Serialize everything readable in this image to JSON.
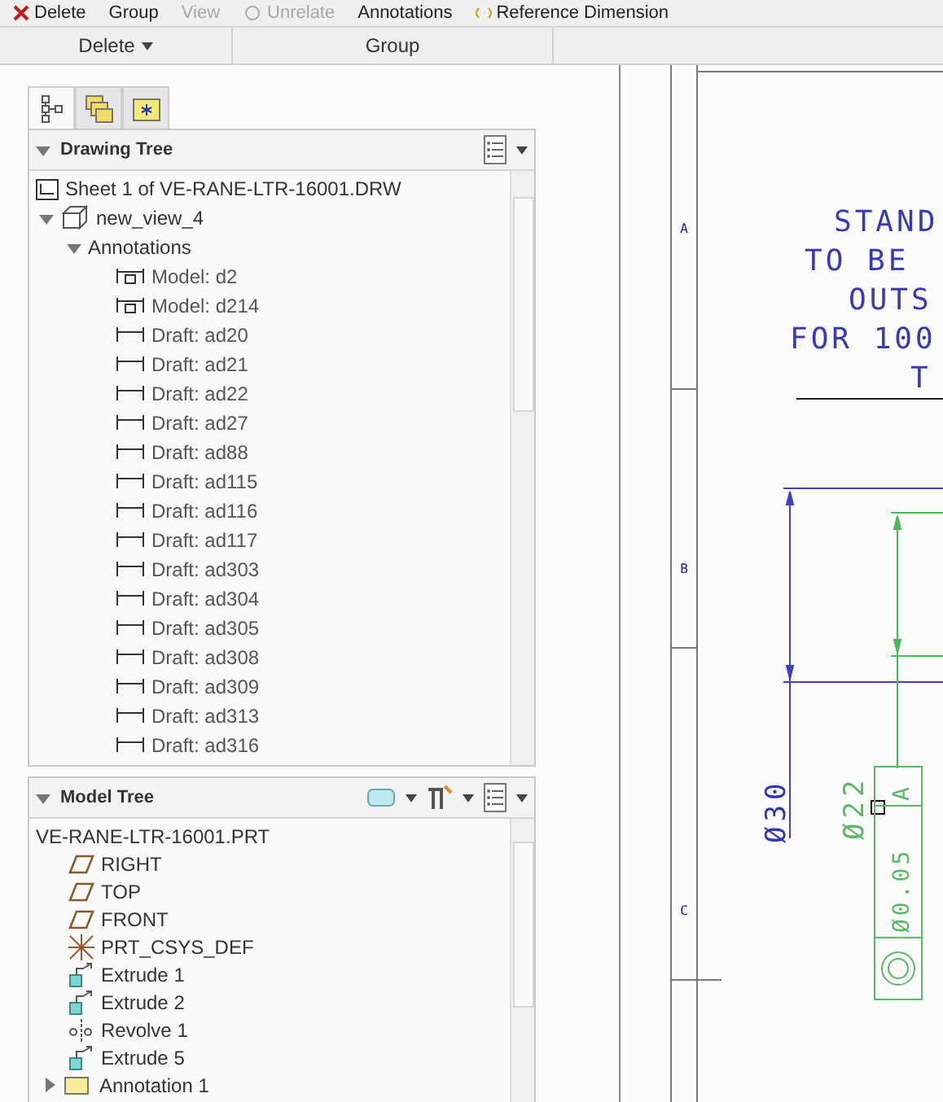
{
  "ribbon": {
    "commands": [
      {
        "label": "Delete",
        "kind": "delete",
        "disabled": false
      },
      {
        "label": "Group",
        "kind": "plain",
        "disabled": false
      },
      {
        "label": "View",
        "kind": "plain",
        "disabled": true
      },
      {
        "label": "Unrelate",
        "kind": "unrelate",
        "disabled": true
      },
      {
        "label": "Annotations",
        "kind": "plain",
        "disabled": false
      },
      {
        "label": "Reference Dimension",
        "kind": "refdim",
        "disabled": false
      }
    ],
    "groups": [
      {
        "label": "Delete",
        "dropdown": true
      },
      {
        "label": "Group",
        "dropdown": false
      }
    ]
  },
  "panel_tabs": [
    {
      "kind": "tree",
      "selected": true
    },
    {
      "kind": "folders",
      "selected": false
    },
    {
      "kind": "favorites",
      "selected": false
    }
  ],
  "drawing_tree": {
    "title": "Drawing Tree",
    "expanded": true,
    "sheet": "Sheet 1 of VE-RANE-LTR-16001.DRW",
    "items": [
      {
        "label": "new_view_4",
        "kind": "view",
        "expanded": true,
        "children": [
          {
            "label": "Annotations",
            "expanded": true,
            "children": [
              {
                "label": "Model: d2",
                "kind": "model"
              },
              {
                "label": "Model: d214",
                "kind": "model"
              },
              {
                "label": "Draft: ad20",
                "kind": "draft"
              },
              {
                "label": "Draft: ad21",
                "kind": "draft"
              },
              {
                "label": "Draft: ad22",
                "kind": "draft"
              },
              {
                "label": "Draft: ad27",
                "kind": "draft"
              },
              {
                "label": "Draft: ad88",
                "kind": "draft"
              },
              {
                "label": "Draft: ad115",
                "kind": "draft"
              },
              {
                "label": "Draft: ad116",
                "kind": "draft"
              },
              {
                "label": "Draft: ad117",
                "kind": "draft"
              },
              {
                "label": "Draft: ad303",
                "kind": "draft"
              },
              {
                "label": "Draft: ad304",
                "kind": "draft"
              },
              {
                "label": "Draft: ad305",
                "kind": "draft"
              },
              {
                "label": "Draft: ad308",
                "kind": "draft"
              },
              {
                "label": "Draft: ad309",
                "kind": "draft"
              },
              {
                "label": "Draft: ad313",
                "kind": "draft"
              },
              {
                "label": "Draft: ad316",
                "kind": "draft"
              }
            ]
          }
        ]
      }
    ]
  },
  "model_tree": {
    "title": "Model Tree",
    "expanded": true,
    "root": "VE-RANE-LTR-16001.PRT",
    "items": [
      {
        "label": "RIGHT",
        "kind": "plane"
      },
      {
        "label": "TOP",
        "kind": "plane"
      },
      {
        "label": "FRONT",
        "kind": "plane"
      },
      {
        "label": "PRT_CSYS_DEF",
        "kind": "csys"
      },
      {
        "label": "Extrude 1",
        "kind": "extrude"
      },
      {
        "label": "Extrude 2",
        "kind": "extrude"
      },
      {
        "label": "Revolve 1",
        "kind": "revolve"
      },
      {
        "label": "Extrude 5",
        "kind": "extrude"
      },
      {
        "label": "Annotation 1",
        "kind": "annotation",
        "expanded": false
      }
    ]
  },
  "drawing": {
    "zones": [
      "A",
      "B",
      "C"
    ],
    "note": [
      "STAND",
      "TO BE",
      "OUTS",
      "FOR 100",
      "T"
    ],
    "dim_outer": "Ø30",
    "dim_inner": "Ø22",
    "frame": {
      "tolerance": "Ø0.05",
      "datum": "A"
    }
  }
}
